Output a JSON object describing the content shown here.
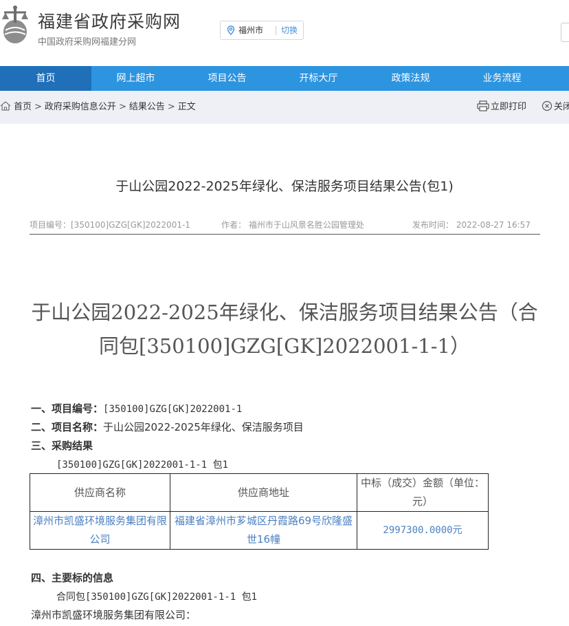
{
  "header": {
    "site_name": "福建省政府采购网",
    "site_sub": "中国政府采购网福建分网",
    "city": "福州市",
    "switch_label": "切换"
  },
  "nav": {
    "items": [
      {
        "label": "首页",
        "active": true
      },
      {
        "label": "网上超市"
      },
      {
        "label": "项目公告"
      },
      {
        "label": "开标大厅"
      },
      {
        "label": "政策法规"
      },
      {
        "label": "业务流程"
      }
    ]
  },
  "breadcrumb": {
    "home": "首页",
    "sep": ">",
    "items": [
      "政府采购信息公开",
      "结果公告",
      "正文"
    ]
  },
  "tools": {
    "print": "立即打印",
    "close": "关闭"
  },
  "article": {
    "title": "于山公园2022-2025年绿化、保洁服务项目结果公告(包1)",
    "meta": {
      "project_no": "项目编号：[350100]GZG[GK]2022001-1",
      "author": "作者： 福州市于山风景名胜公园管理处",
      "publish_time": "发布时间： 2022-08-27 16:57"
    },
    "big_title": "于山公园2022-2025年绿化、保洁服务项目结果公告（合同包[350100]GZG[GK]2022001-1-1）",
    "sec1_label": "一、项目编号：",
    "sec1_value": "[350100]GZG[GK]2022001-1",
    "sec2_label": "二、项目名称：",
    "sec2_value": "于山公园2022-2025年绿化、保洁服务项目",
    "sec3_label": "三、采购结果",
    "sec3_pkg": "[350100]GZG[GK]2022001-1-1 包1",
    "table": {
      "headers": [
        "供应商名称",
        "供应商地址",
        "中标（成交）金额（单位：元）"
      ],
      "rows": [
        [
          "漳州市凯盛环境服务集团有限公司",
          "福建省漳州市芗城区丹霞路69号欣隆盛世16幢",
          "2997300.0000元"
        ]
      ]
    },
    "sec4_label": "四、主要标的信息",
    "sec4_pkg": "合同包[350100]GZG[GK]2022001-1-1 包1",
    "sec4_supplier": "漳州市凯盛环境服务集团有限公司："
  },
  "colors": {
    "nav_bg": "#2d94e0",
    "nav_active": "#1f6fb9",
    "link_blue": "#4a7fc1"
  }
}
